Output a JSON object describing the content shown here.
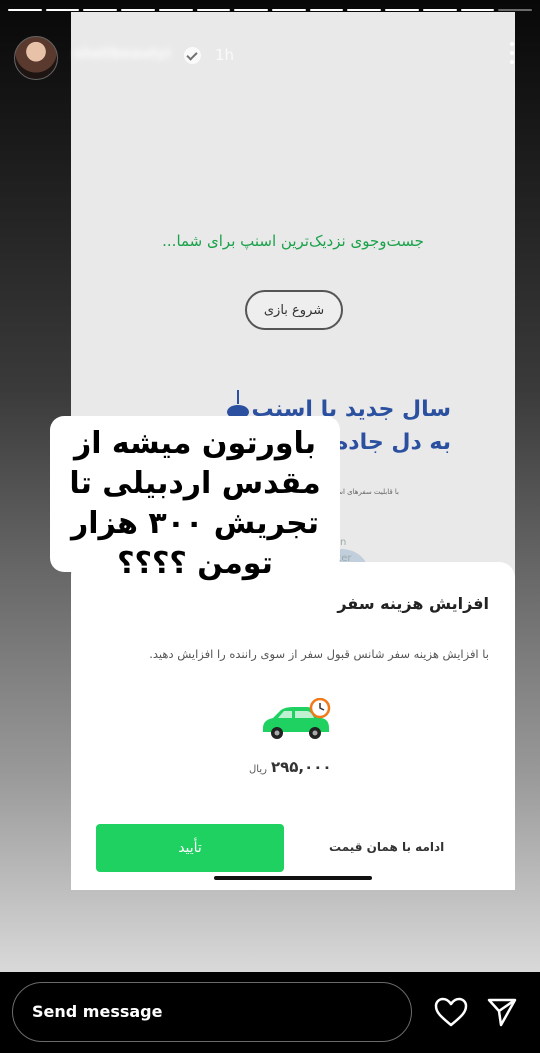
{
  "story": {
    "progress_segments": 14,
    "progress_done": 13,
    "username": "shelibeautyi",
    "time": "1h",
    "more_icon": "more-vertical-icon"
  },
  "screenshot": {
    "searching_text": "جست‌وجوی نزدیک‌ترین اسنپ برای شما...",
    "start_game_label": "شروع بازی",
    "banner_line1": "سال جدید با اسنپ",
    "banner_line2": "به دل جاده",
    "banner_small": "با قابلیت سفرهای استانی",
    "watermark": [
      "Official",
      "Persian",
      "Twitter"
    ],
    "sheet": {
      "title": "افزایش هزینه سفر",
      "description": "با افزایش هزینه سفر شانس قبول سفر از سوی راننده را افزایش دهید.",
      "price": "۲۹۵,۰۰۰",
      "price_unit": "ریال",
      "confirm_label": "تأیید",
      "continue_label": "ادامه با همان قیمت"
    },
    "accent_green": "#1ed161"
  },
  "caption": {
    "text": "باورتون میشه از مقدس اردبیلی تا تجریش ۳۰۰ هزار تومن ؟؟؟؟"
  },
  "bottom_bar": {
    "message_placeholder": "Send message",
    "like_icon": "heart-icon",
    "share_icon": "send-icon"
  }
}
